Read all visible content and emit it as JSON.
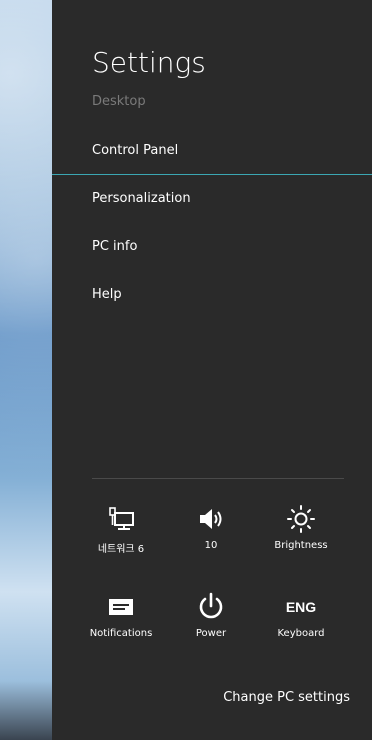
{
  "panel": {
    "title": "Settings",
    "subtitle": "Desktop",
    "control_panel": "Control Panel",
    "items": [
      "Personalization",
      "PC info",
      "Help"
    ],
    "accent_color": "#3ba7b3"
  },
  "quick_settings": [
    {
      "icon": "network-icon",
      "label": "네트워크 6"
    },
    {
      "icon": "volume-icon",
      "label": "10"
    },
    {
      "icon": "brightness-icon",
      "label": "Brightness"
    },
    {
      "icon": "notifications-icon",
      "label": "Notifications"
    },
    {
      "icon": "power-icon",
      "label": "Power"
    },
    {
      "icon": "keyboard-icon",
      "label": "Keyboard",
      "glyph": "ENG"
    }
  ],
  "footer": {
    "change_pc_settings": "Change PC settings"
  }
}
